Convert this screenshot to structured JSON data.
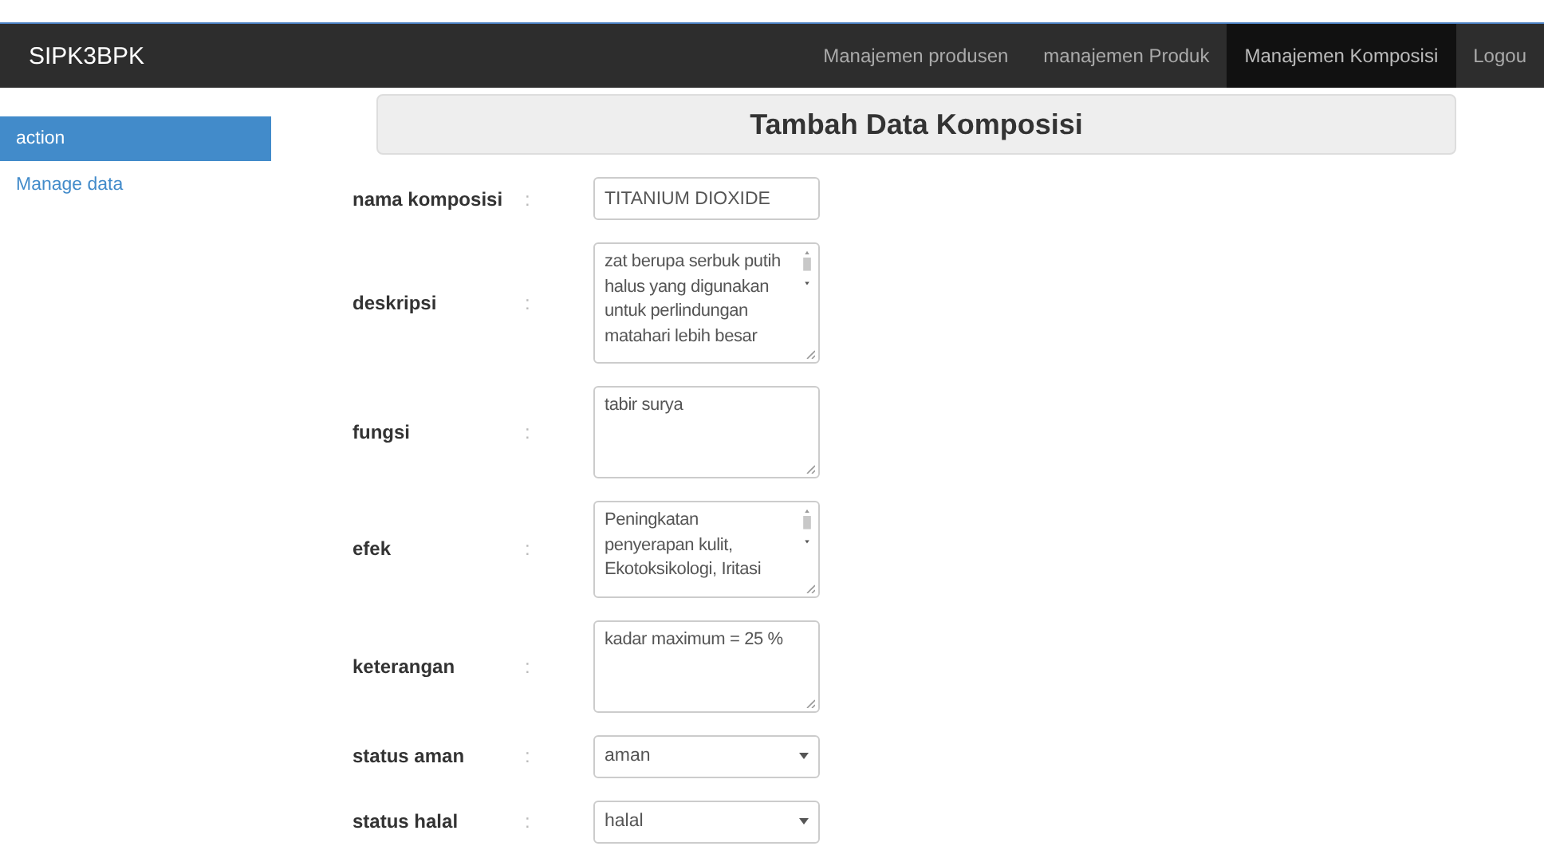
{
  "navbar": {
    "brand": "SIPK3BPK",
    "items": [
      {
        "label": "Manajemen produsen",
        "selected": false
      },
      {
        "label": "manajemen Produk",
        "selected": false
      },
      {
        "label": "Manajemen Komposisi",
        "selected": true
      },
      {
        "label": "Logou",
        "selected": false
      }
    ]
  },
  "sidebar": {
    "items": [
      {
        "label": "action",
        "selected": true
      },
      {
        "label": "Manage data",
        "selected": false
      }
    ]
  },
  "form": {
    "title": "Tambah Data Komposisi",
    "fields": [
      {
        "kind": "input",
        "label": "nama komposisi",
        "separator": ":",
        "value": "TITANIUM DIOXIDE"
      },
      {
        "kind": "textarea",
        "label": "deskripsi",
        "separator": ":",
        "value": "zat berupa serbuk putih halus yang digunakan untuk perlindungan matahari lebih besar",
        "scrollable": true
      },
      {
        "kind": "textarea",
        "label": "fungsi",
        "separator": ":",
        "value": "tabir surya",
        "scrollable": false
      },
      {
        "kind": "textarea",
        "label": "efek",
        "separator": ":",
        "value": "Peningkatan penyerapan kulit, Ekotoksikologi, Iritasi",
        "scrollable": true
      },
      {
        "kind": "textarea",
        "label": "keterangan",
        "separator": ":",
        "value": "kadar maximum = 25 %",
        "scrollable": false
      },
      {
        "kind": "select",
        "label": "status aman",
        "separator": ":",
        "value": "aman"
      },
      {
        "kind": "select",
        "label": "status halal",
        "separator": ":",
        "value": "halal"
      }
    ]
  }
}
